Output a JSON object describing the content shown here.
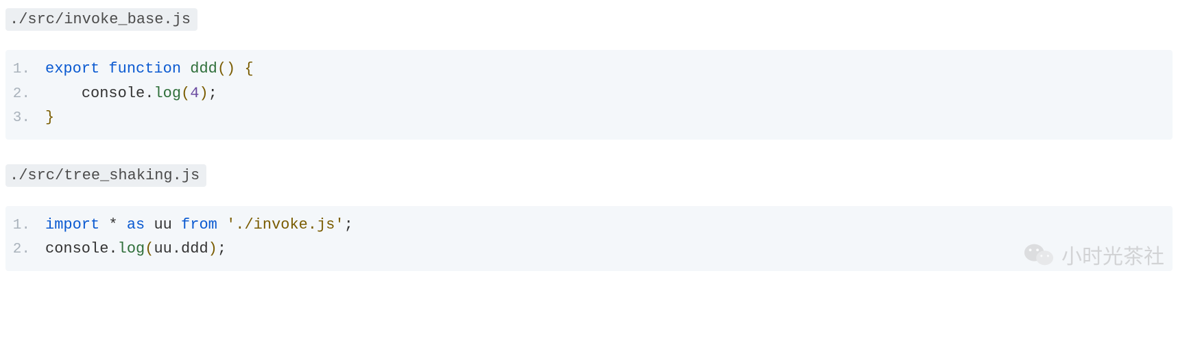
{
  "files": [
    {
      "path": "./src/invoke_base.js",
      "lines": [
        {
          "n": "1.",
          "tokens": [
            {
              "t": "export",
              "c": "tk-kw"
            },
            {
              "t": " ",
              "c": ""
            },
            {
              "t": "function",
              "c": "tk-kw"
            },
            {
              "t": " ",
              "c": ""
            },
            {
              "t": "ddd",
              "c": "tk-fn"
            },
            {
              "t": "()",
              "c": "tk-par"
            },
            {
              "t": " ",
              "c": ""
            },
            {
              "t": "{",
              "c": "tk-par"
            }
          ]
        },
        {
          "n": "2.",
          "tokens": [
            {
              "t": "    ",
              "c": ""
            },
            {
              "t": "console",
              "c": "tk-id"
            },
            {
              "t": ".",
              "c": "tk-punc"
            },
            {
              "t": "log",
              "c": "tk-fn"
            },
            {
              "t": "(",
              "c": "tk-par"
            },
            {
              "t": "4",
              "c": "tk-num"
            },
            {
              "t": ")",
              "c": "tk-par"
            },
            {
              "t": ";",
              "c": "tk-punc"
            }
          ]
        },
        {
          "n": "3.",
          "tokens": [
            {
              "t": "}",
              "c": "tk-par"
            }
          ]
        }
      ]
    },
    {
      "path": "./src/tree_shaking.js",
      "lines": [
        {
          "n": "1.",
          "tokens": [
            {
              "t": "import",
              "c": "tk-kw"
            },
            {
              "t": " ",
              "c": ""
            },
            {
              "t": "*",
              "c": "tk-punc"
            },
            {
              "t": " ",
              "c": ""
            },
            {
              "t": "as",
              "c": "tk-kw"
            },
            {
              "t": " ",
              "c": ""
            },
            {
              "t": "uu",
              "c": "tk-id"
            },
            {
              "t": " ",
              "c": ""
            },
            {
              "t": "from",
              "c": "tk-kw"
            },
            {
              "t": " ",
              "c": ""
            },
            {
              "t": "'./invoke.js'",
              "c": "tk-str"
            },
            {
              "t": ";",
              "c": "tk-punc"
            }
          ]
        },
        {
          "n": "2.",
          "tokens": [
            {
              "t": "console",
              "c": "tk-id"
            },
            {
              "t": ".",
              "c": "tk-punc"
            },
            {
              "t": "log",
              "c": "tk-fn"
            },
            {
              "t": "(",
              "c": "tk-par"
            },
            {
              "t": "uu",
              "c": "tk-id"
            },
            {
              "t": ".",
              "c": "tk-punc"
            },
            {
              "t": "ddd",
              "c": "tk-id"
            },
            {
              "t": ")",
              "c": "tk-par"
            },
            {
              "t": ";",
              "c": "tk-punc"
            }
          ]
        }
      ]
    }
  ],
  "watermark": "小时光茶社"
}
